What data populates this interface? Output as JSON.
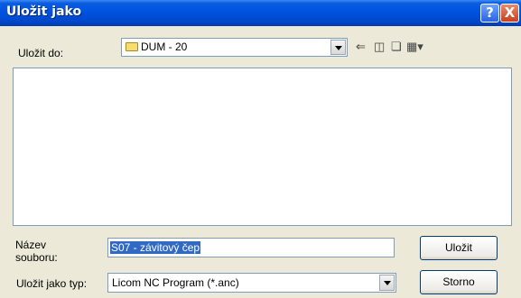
{
  "window": {
    "title": "Uložit jako"
  },
  "titlebar": {
    "help_symbol": "?",
    "close_symbol": "X"
  },
  "location": {
    "label": "Uložit do:",
    "value": "DUM - 20"
  },
  "toolbar": {
    "back_icon": "back-arrow-icon",
    "up_icon": "up-folder-icon",
    "new_folder_icon": "new-folder-icon",
    "views_icon": "view-menu-icon"
  },
  "file_list": {
    "items": []
  },
  "filename": {
    "label_line1": "Název",
    "label_line2": "souboru:",
    "value": "S07 - závitový čep"
  },
  "filetype": {
    "label": "Uložit jako typ:",
    "value": "Licom NC Program (*.anc)"
  },
  "buttons": {
    "save_label": "Uložit",
    "cancel_label": "Storno"
  },
  "colors": {
    "titlebar": "#0054e3",
    "dialog_bg": "#ece9d8",
    "selection": "#316ac5",
    "close_button": "#c8401c"
  }
}
